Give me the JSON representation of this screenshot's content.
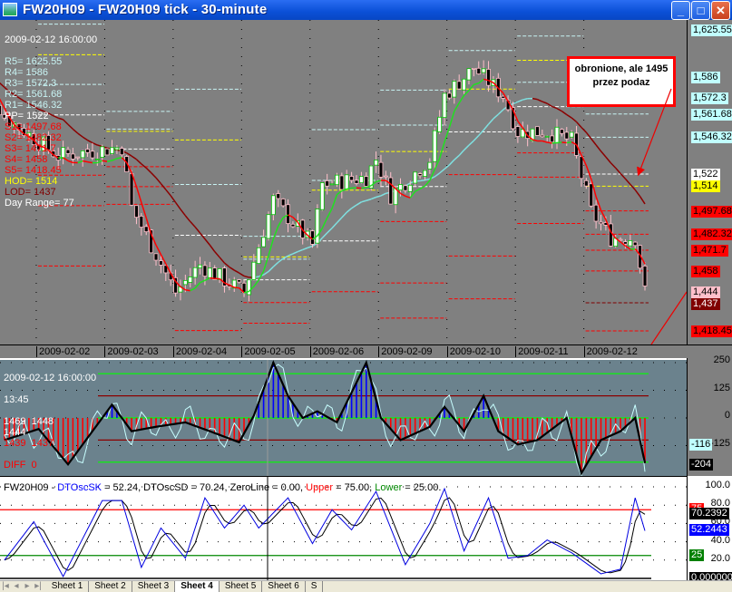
{
  "window": {
    "title": "FW20H09 - FW20H09 tick - 30-minute",
    "buttons": {
      "minimize": "_",
      "maximize": "□",
      "close": "✕"
    }
  },
  "overlay": {
    "timestamp": "2009-02-12 16:00:00",
    "levels": [
      {
        "text": "R5= 1625.55",
        "color": "#c8f4f4"
      },
      {
        "text": "R4= 1586",
        "color": "#c8f4f4"
      },
      {
        "text": "R3= 1572.3",
        "color": "#c8f4f4"
      },
      {
        "text": "R2= 1561.68",
        "color": "#c8f4f4"
      },
      {
        "text": "R1= 1546.32",
        "color": "#c8f4f4"
      },
      {
        "text": "PP= 1522",
        "color": "#ffffff"
      },
      {
        "text": "S1= 1497.68",
        "color": "#ff0000"
      },
      {
        "text": "S2= 1482.32",
        "color": "#ff0000"
      },
      {
        "text": "S3= 1471.7",
        "color": "#ff0000"
      },
      {
        "text": "S4= 1458",
        "color": "#ff0000"
      },
      {
        "text": "S5= 1418.45",
        "color": "#ff0000"
      },
      {
        "text": "HOD= 1514",
        "color": "#ffff00"
      },
      {
        "text": "LOD= 1437",
        "color": "#800000"
      },
      {
        "text": "Day Range= 77",
        "color": "#ffffff"
      }
    ]
  },
  "annotation": "obronione, ale 1495 przez podaz",
  "price_scale": [
    {
      "text": "1,625.55",
      "value": 1625.55,
      "bg": "#c0ffff",
      "fg": "#000000"
    },
    {
      "text": "1,586",
      "value": 1586,
      "bg": "#c0ffff",
      "fg": "#000000"
    },
    {
      "text": "1,572.3",
      "value": 1572.3,
      "bg": "#c0ffff",
      "fg": "#000000"
    },
    {
      "text": "1,561.68",
      "value": 1561.68,
      "bg": "#c0ffff",
      "fg": "#000000"
    },
    {
      "text": "1,546.32",
      "value": 1546.32,
      "bg": "#c0ffff",
      "fg": "#000000"
    },
    {
      "text": "1,522",
      "value": 1522,
      "bg": "#ffffff",
      "fg": "#000000"
    },
    {
      "text": "1,514",
      "value": 1514,
      "bg": "#ffff00",
      "fg": "#000000"
    },
    {
      "text": "1,497.68",
      "value": 1497.68,
      "bg": "#ff0000",
      "fg": "#000000"
    },
    {
      "text": "1,482.32",
      "value": 1482.32,
      "bg": "#ff0000",
      "fg": "#000000"
    },
    {
      "text": "1,471.7",
      "value": 1471.7,
      "bg": "#ff0000",
      "fg": "#000000"
    },
    {
      "text": "1,458",
      "value": 1458,
      "bg": "#ff0000",
      "fg": "#000000"
    },
    {
      "text": "1,444",
      "value": 1444,
      "bg": "#ffc0cb",
      "fg": "#000000"
    },
    {
      "text": "1,437",
      "value": 1437,
      "bg": "#800000",
      "fg": "#ffffff"
    },
    {
      "text": "1,418.45",
      "value": 1418.45,
      "bg": "#ff0000",
      "fg": "#000000"
    }
  ],
  "dates": [
    "2009-02-02",
    "2009-02-03",
    "2009-02-04",
    "2009-02-05",
    "2009-02-06",
    "2009-02-09",
    "2009-02-10",
    "2009-02-11",
    "2009-02-12"
  ],
  "oscillator": {
    "labels": {
      "timestamp": "2009-02-12 16:00:00",
      "time": "13:45",
      "row1": "1469  1448",
      "row2": "1444",
      "row3": "1439  1437",
      "diff": "DIFF  0"
    },
    "scale": [
      "250",
      "125",
      "0",
      "-125"
    ],
    "value_labels": [
      {
        "text": "-116",
        "value": -116,
        "bg": "#c0ffff",
        "fg": "#000000"
      },
      {
        "text": "-204",
        "value": -204,
        "bg": "#000000",
        "fg": "#ffffff"
      }
    ]
  },
  "stochastic": {
    "header": {
      "symbol": "FW20H09 - ",
      "k_name": "DTOscSK",
      "k_rest": " = 52.24, DTOscSD = 70.24, ZeroLine = 0.00, ",
      "upper_name": "Upper",
      "upper_rest": " = 75.00, ",
      "lower_name": "Lower",
      "lower_rest": " = 25.00."
    },
    "scale": [
      "100.0",
      "80.0",
      "60.0",
      "40.0",
      "20.0"
    ],
    "value_labels": [
      {
        "text": "75",
        "value": 75,
        "bg": "#ff0000"
      },
      {
        "text": "70.2392",
        "value": 70.24,
        "bg": "#000000"
      },
      {
        "text": "52.2443",
        "value": 52.24,
        "bg": "#0000ff"
      },
      {
        "text": "25",
        "value": 25,
        "bg": "#008000"
      },
      {
        "text": "0.000000",
        "value": 0,
        "bg": "#000000"
      }
    ]
  },
  "tabs": {
    "items": [
      "Sheet 1",
      "Sheet 2",
      "Sheet 3",
      "Sheet 4",
      "Sheet 5",
      "Sheet 6",
      "S"
    ],
    "active": 3
  },
  "chart_data": {
    "type": "candlestick",
    "bars_per_day": 14,
    "bars": 139,
    "price_path": [
      [
        0,
        1600
      ],
      [
        7,
        1560
      ],
      [
        18,
        1534
      ],
      [
        31,
        1540
      ],
      [
        33,
        1500
      ],
      [
        42,
        1444
      ],
      [
        47,
        1462
      ],
      [
        56,
        1444
      ],
      [
        62,
        1505
      ],
      [
        70,
        1475
      ],
      [
        72,
        1515
      ],
      [
        81,
        1520
      ],
      [
        83,
        1532
      ],
      [
        86,
        1508
      ],
      [
        94,
        1532
      ],
      [
        97,
        1574
      ],
      [
        103,
        1592
      ],
      [
        109,
        1574
      ],
      [
        112,
        1550
      ],
      [
        118,
        1550
      ],
      [
        123,
        1544
      ],
      [
        127,
        1497
      ],
      [
        131,
        1480
      ],
      [
        136,
        1480
      ],
      [
        138,
        1444
      ]
    ],
    "last_day_pivots": {
      "R5": 1625.55,
      "R4": 1586,
      "R3": 1572.3,
      "R2": 1561.68,
      "R1": 1546.32,
      "PP": 1522,
      "HOD": 1514,
      "S1": 1497.68,
      "S2": 1482.32,
      "S3": 1471.7,
      "S4": 1458,
      "LOD": 1437,
      "S5": 1418.45
    },
    "osc_path": [
      [
        7,
        -100
      ],
      [
        14,
        -50
      ],
      [
        20,
        -210
      ],
      [
        25,
        -60
      ],
      [
        29,
        60
      ],
      [
        33,
        -60
      ],
      [
        38,
        -40
      ],
      [
        44,
        -20
      ],
      [
        49,
        -60
      ],
      [
        55,
        -110
      ],
      [
        58,
        10
      ],
      [
        62,
        250
      ],
      [
        65,
        100
      ],
      [
        68,
        0
      ],
      [
        71,
        30
      ],
      [
        75,
        -20
      ],
      [
        81,
        250
      ],
      [
        84,
        0
      ],
      [
        88,
        -100
      ],
      [
        94,
        -40
      ],
      [
        97,
        50
      ],
      [
        101,
        -60
      ],
      [
        105,
        100
      ],
      [
        108,
        -60
      ],
      [
        112,
        -120
      ],
      [
        116,
        -100
      ],
      [
        122,
        0
      ],
      [
        125,
        -250
      ],
      [
        129,
        -100
      ],
      [
        133,
        -60
      ],
      [
        136,
        0
      ],
      [
        138,
        -204
      ]
    ],
    "stoch_k_path": [
      [
        7,
        20
      ],
      [
        13,
        62
      ],
      [
        19,
        2
      ],
      [
        27,
        85
      ],
      [
        31,
        85
      ],
      [
        35,
        12
      ],
      [
        39,
        55
      ],
      [
        44,
        22
      ],
      [
        48,
        88
      ],
      [
        52,
        55
      ],
      [
        56,
        80
      ],
      [
        59,
        55
      ],
      [
        65,
        88
      ],
      [
        70,
        38
      ],
      [
        74,
        75
      ],
      [
        78,
        53
      ],
      [
        83,
        95
      ],
      [
        89,
        15
      ],
      [
        94,
        60
      ],
      [
        97,
        98
      ],
      [
        101,
        30
      ],
      [
        106,
        88
      ],
      [
        110,
        22
      ],
      [
        114,
        25
      ],
      [
        118,
        42
      ],
      [
        123,
        28
      ],
      [
        129,
        5
      ],
      [
        133,
        10
      ],
      [
        136,
        88
      ],
      [
        138,
        52
      ]
    ],
    "stoch_upper": 75,
    "stoch_lower": 25
  }
}
